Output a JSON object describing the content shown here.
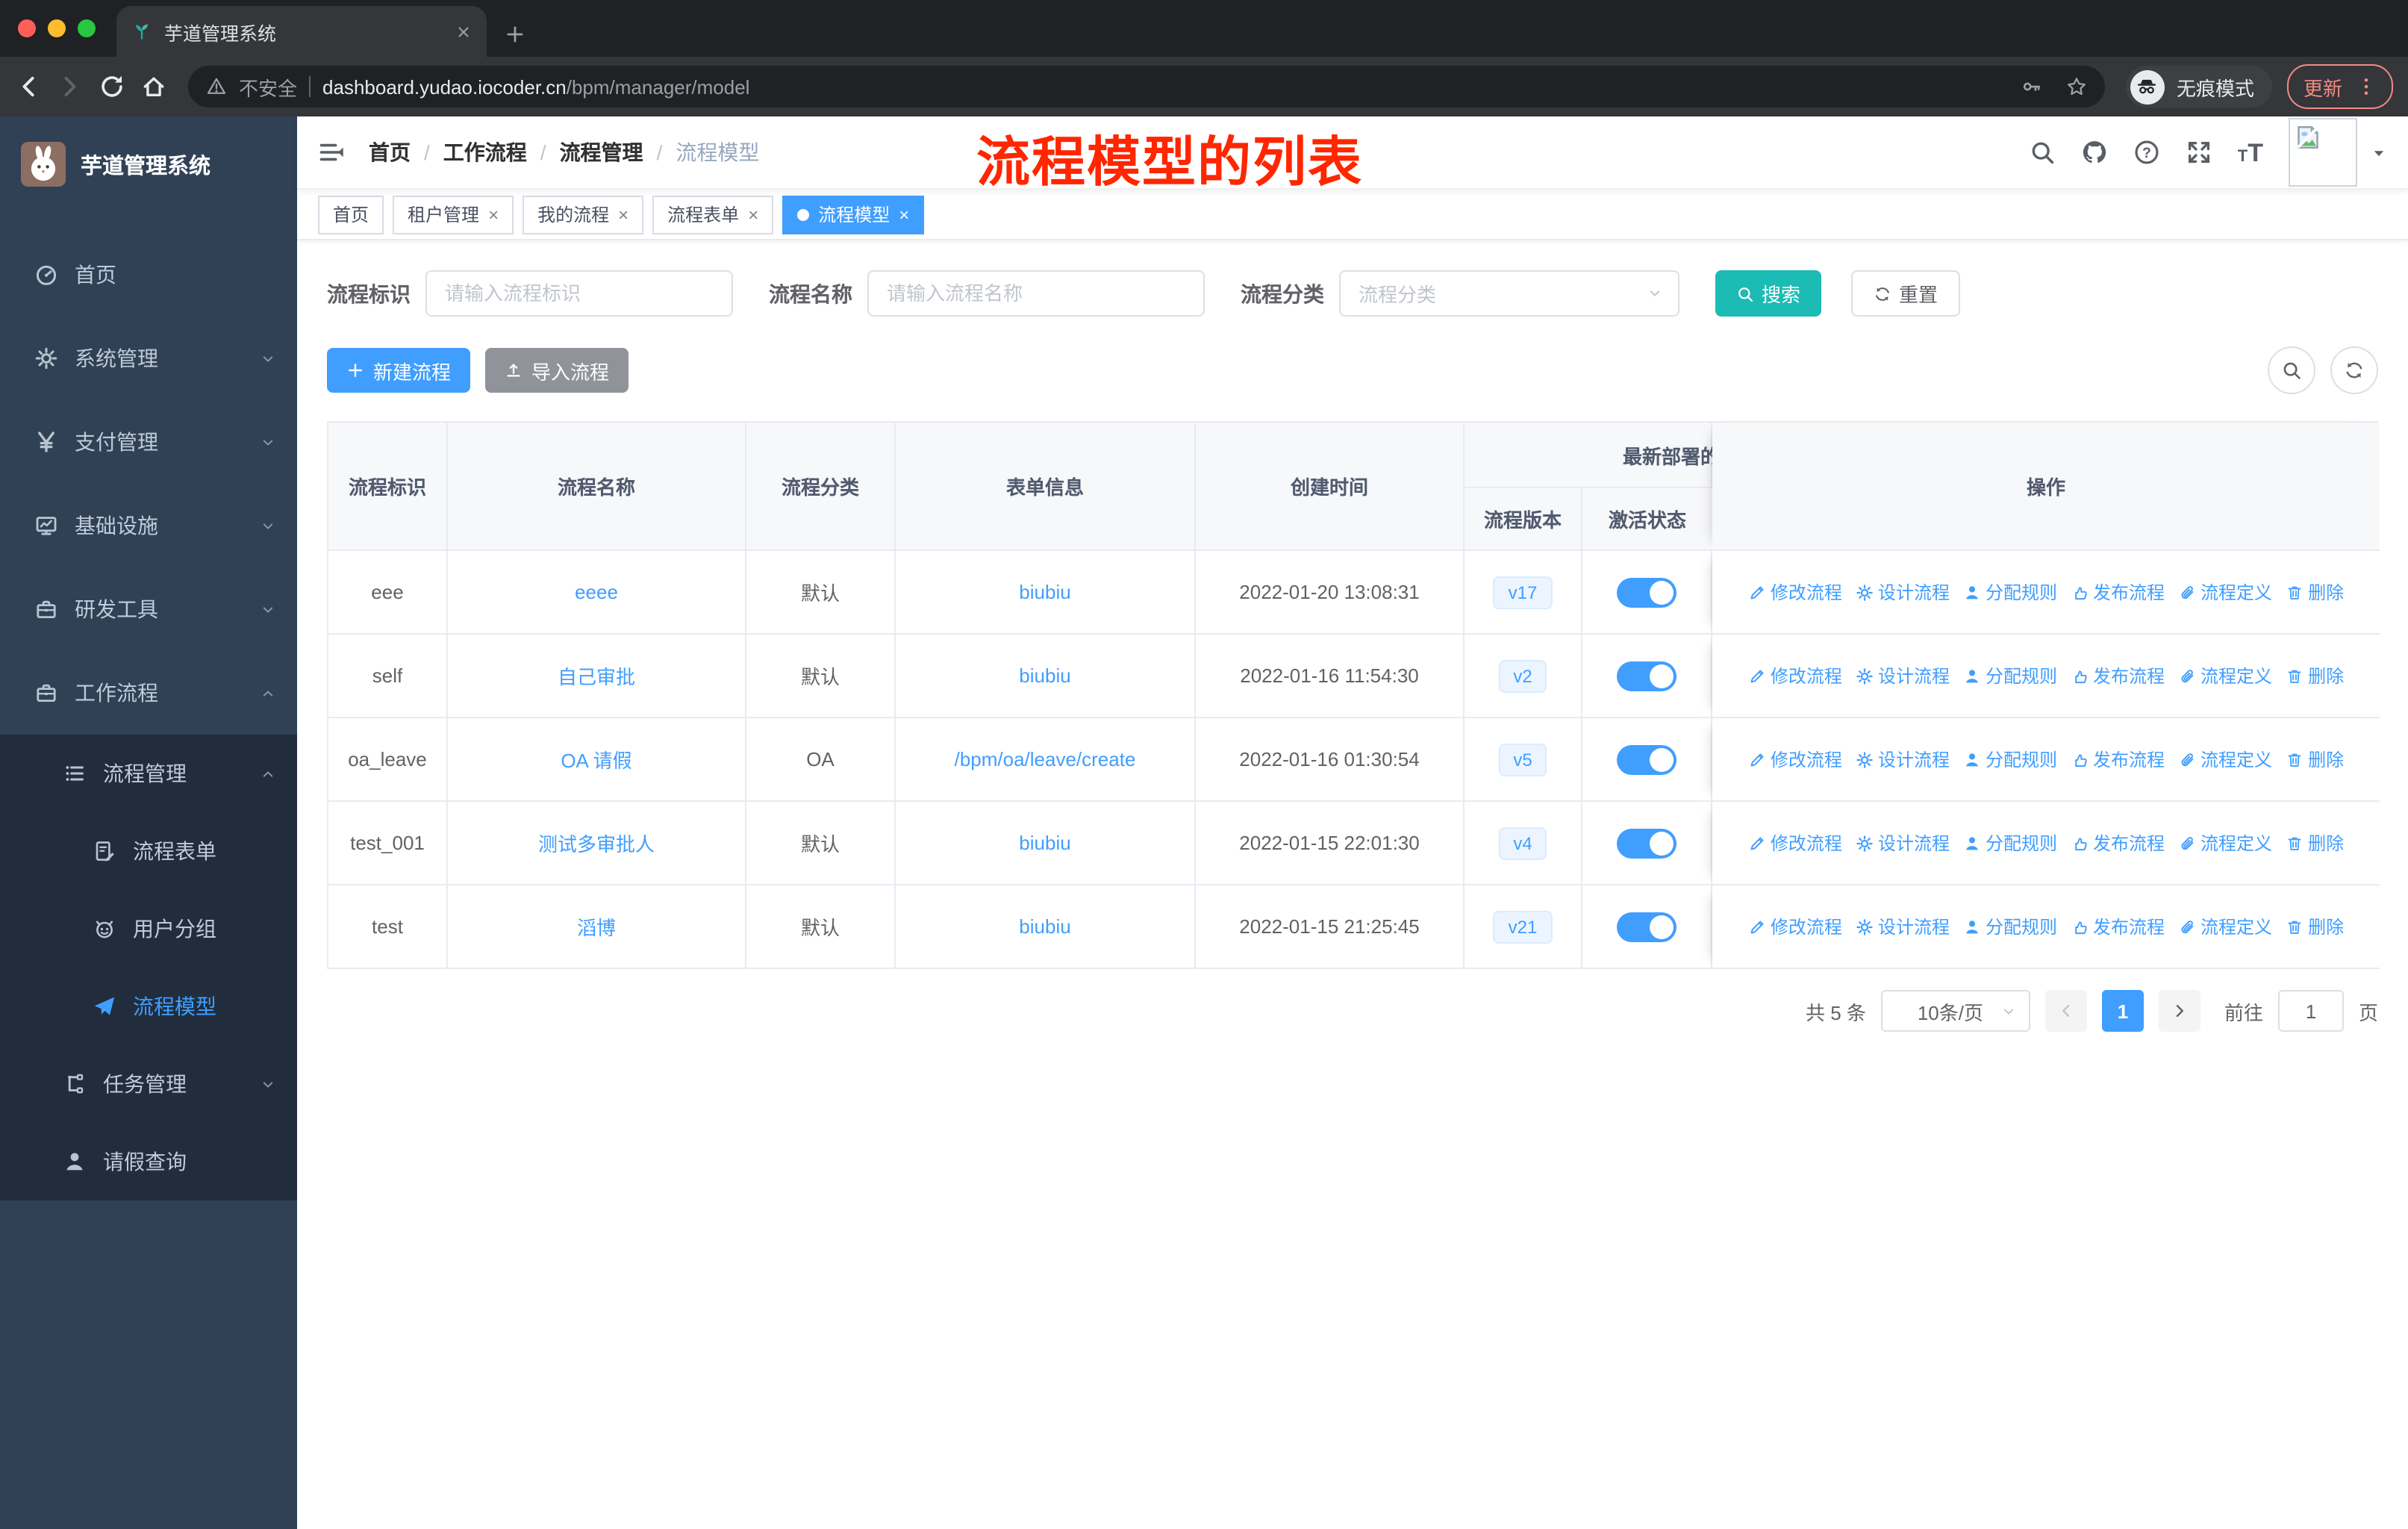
{
  "browser": {
    "tab_title": "芋道管理系统",
    "secure_label": "不安全",
    "url_host": "dashboard.yudao.iocoder.cn",
    "url_path": "/bpm/manager/model",
    "incognito_label": "无痕模式",
    "update_label": "更新"
  },
  "sidebar": {
    "app_title": "芋道管理系统",
    "items": [
      {
        "label": "首页",
        "icon": "dashboard-icon",
        "expandable": false
      },
      {
        "label": "系统管理",
        "icon": "gear-icon",
        "expandable": true
      },
      {
        "label": "支付管理",
        "icon": "yen-icon",
        "expandable": true
      },
      {
        "label": "基础设施",
        "icon": "monitor-icon",
        "expandable": true
      },
      {
        "label": "研发工具",
        "icon": "toolbox-icon",
        "expandable": true
      },
      {
        "label": "工作流程",
        "icon": "briefcase-icon",
        "expandable": true,
        "expanded": true
      }
    ],
    "submenu": {
      "parent": "流程管理",
      "children": [
        {
          "label": "流程表单",
          "icon": "form-icon",
          "active": false
        },
        {
          "label": "用户分组",
          "icon": "robot-icon",
          "active": false
        },
        {
          "label": "流程模型",
          "icon": "paper-plane-icon",
          "active": true
        }
      ],
      "tasks": "任务管理",
      "leave": "请假查询"
    }
  },
  "navbar": {
    "breadcrumb": [
      "首页",
      "工作流程",
      "流程管理",
      "流程模型"
    ],
    "annotation": "流程模型的列表"
  },
  "tags": [
    {
      "label": "首页",
      "closable": false,
      "active": false
    },
    {
      "label": "租户管理",
      "closable": true,
      "active": false
    },
    {
      "label": "我的流程",
      "closable": true,
      "active": false
    },
    {
      "label": "流程表单",
      "closable": true,
      "active": false
    },
    {
      "label": "流程模型",
      "closable": true,
      "active": true
    }
  ],
  "filters": {
    "key_label": "流程标识",
    "key_placeholder": "请输入流程标识",
    "name_label": "流程名称",
    "name_placeholder": "请输入流程名称",
    "category_label": "流程分类",
    "category_placeholder": "流程分类",
    "search_label": "搜索",
    "reset_label": "重置"
  },
  "toolbar": {
    "create_label": "新建流程",
    "import_label": "导入流程"
  },
  "table": {
    "columns": [
      "流程标识",
      "流程名称",
      "流程分类",
      "表单信息",
      "创建时间"
    ],
    "group_header": "最新部署的",
    "sub_columns": [
      "流程版本",
      "激活状态"
    ],
    "op_column": "操作",
    "actions": [
      {
        "label": "修改流程",
        "icon": "edit"
      },
      {
        "label": "设计流程",
        "icon": "gear"
      },
      {
        "label": "分配规则",
        "icon": "user"
      },
      {
        "label": "发布流程",
        "icon": "hand"
      },
      {
        "label": "流程定义",
        "icon": "clip"
      },
      {
        "label": "删除",
        "icon": "trash"
      }
    ],
    "rows": [
      {
        "key": "eee",
        "name": "eeee",
        "category": "默认",
        "form": "biubiu",
        "created": "2022-01-20 13:08:31",
        "version": "v17",
        "active": true
      },
      {
        "key": "self",
        "name": "自己审批",
        "category": "默认",
        "form": "biubiu",
        "created": "2022-01-16 11:54:30",
        "version": "v2",
        "active": true
      },
      {
        "key": "oa_leave",
        "name": "OA 请假",
        "category": "OA",
        "form": "/bpm/oa/leave/create",
        "created": "2022-01-16 01:30:54",
        "version": "v5",
        "active": true
      },
      {
        "key": "test_001",
        "name": "测试多审批人",
        "category": "默认",
        "form": "biubiu",
        "created": "2022-01-15 22:01:30",
        "version": "v4",
        "active": true
      },
      {
        "key": "test",
        "name": "滔博",
        "category": "默认",
        "form": "biubiu",
        "created": "2022-01-15 21:25:45",
        "version": "v21",
        "active": true
      }
    ]
  },
  "pagination": {
    "total": "共 5 条",
    "page_size": "10条/页",
    "prev": "‹",
    "page": "1",
    "next": "›",
    "goto_label": "前往",
    "goto_value": "1",
    "unit": "页"
  },
  "colors": {
    "accent": "#409eff",
    "teal": "#1cbbb4",
    "annotation_red": "#ff2600",
    "sidebar_bg": "#304156",
    "submenu_bg": "#212d3d",
    "update_red": "#f28b82"
  }
}
